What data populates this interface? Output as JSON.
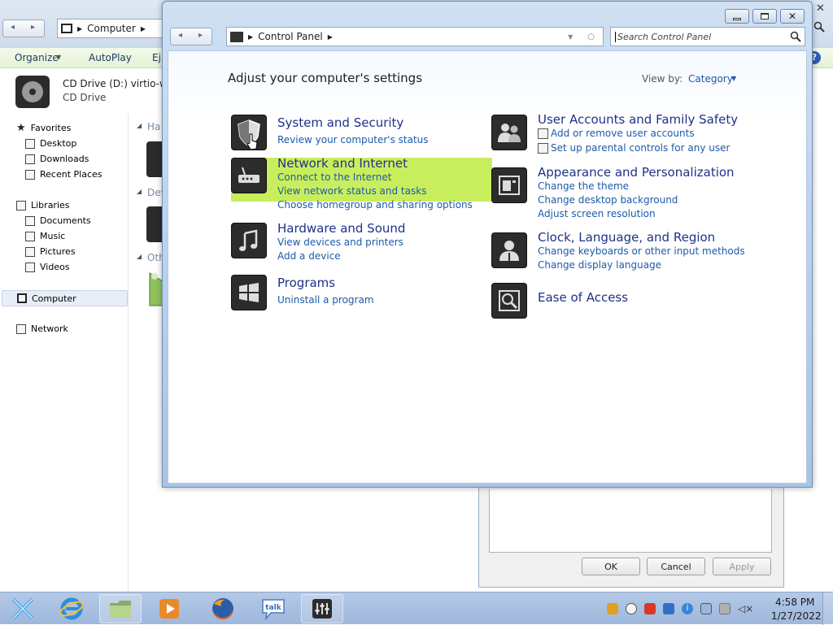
{
  "explorer": {
    "breadcrumb": "Computer",
    "toolbar": {
      "organize": "Organize",
      "autoplay": "AutoPlay",
      "eject": "Ej"
    },
    "drive": {
      "name": "CD Drive (D:) virtio-win",
      "type": "CD Drive"
    },
    "nav": {
      "favorites": "Favorites",
      "favorites_items": [
        "Desktop",
        "Downloads",
        "Recent Places"
      ],
      "libraries": "Libraries",
      "libraries_items": [
        "Documents",
        "Music",
        "Pictures",
        "Videos"
      ],
      "computer": "Computer",
      "network": "Network"
    },
    "groups": [
      "Ha",
      "Dev",
      "Oth"
    ]
  },
  "properties_dialog": {
    "ok": "OK",
    "cancel": "Cancel",
    "apply": "Apply"
  },
  "control_panel": {
    "address": "Control Panel",
    "search_placeholder": "Search Control Panel",
    "heading": "Adjust your computer's settings",
    "view_by_label": "View by:",
    "view_by_value": "Category",
    "categories_left": [
      {
        "title": "System and Security",
        "links": [
          "Review your computer's status"
        ],
        "icon": "shield-icon"
      },
      {
        "title": "Network and Internet",
        "links": [
          "Connect to the Internet",
          "View network status and tasks",
          "Choose homegroup and sharing options"
        ],
        "icon": "router-icon"
      },
      {
        "title": "Hardware and Sound",
        "links": [
          "View devices and printers",
          "Add a device"
        ],
        "icon": "music-note-icon"
      },
      {
        "title": "Programs",
        "links": [
          "Uninstall a program"
        ],
        "icon": "windows-logo-icon"
      }
    ],
    "categories_right": [
      {
        "title": "User Accounts and Family Safety",
        "links": [
          "Add or remove user accounts",
          "Set up parental controls for any user"
        ],
        "icon": "users-icon"
      },
      {
        "title": "Appearance and Personalization",
        "links": [
          "Change the theme",
          "Change desktop background",
          "Adjust screen resolution"
        ],
        "icon": "monitor-icon"
      },
      {
        "title": "Clock, Language, and Region",
        "links": [
          "Change keyboards or other input methods",
          "Change display language"
        ],
        "icon": "person-icon"
      },
      {
        "title": "Ease of Access",
        "links": [],
        "icon": "magnifier-icon"
      }
    ]
  },
  "taskbar": {
    "time": "4:58 PM",
    "date": "1/27/2022",
    "apps": [
      "start-icon",
      "internet-explorer-icon",
      "file-explorer-icon",
      "media-player-icon",
      "firefox-icon",
      "google-talk-icon",
      "control-panel-icon"
    ]
  },
  "colors": {
    "highlight": "#c9ee5d",
    "link": "#1e5aa8",
    "title": "#1e3287"
  }
}
